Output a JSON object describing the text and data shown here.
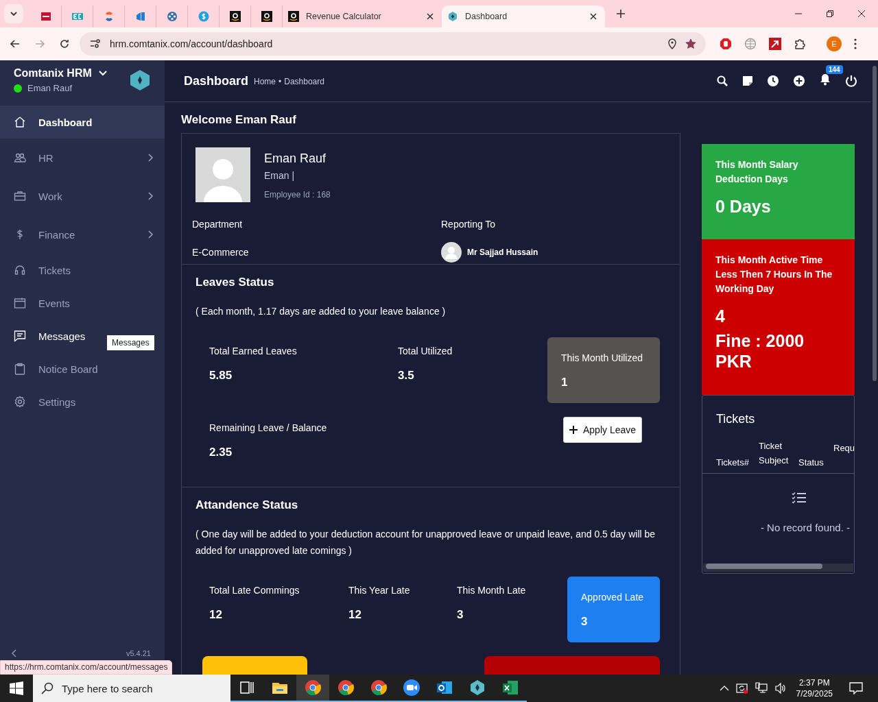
{
  "browser": {
    "tabs": [
      {
        "kind": "red-square",
        "selected": false
      },
      {
        "kind": "ec",
        "selected": false
      },
      {
        "kind": "swirl",
        "selected": false
      },
      {
        "kind": "blue-app",
        "selected": false
      },
      {
        "kind": "dots",
        "selected": false
      },
      {
        "kind": "coin",
        "selected": false
      },
      {
        "kind": "amazon",
        "selected": false
      },
      {
        "kind": "amazon",
        "selected": false
      },
      {
        "kind": "amazon",
        "label": "Revenue Calculator",
        "selected": false
      },
      {
        "kind": "hex",
        "label": "Dashboard",
        "selected": true
      }
    ],
    "url": "hrm.comtanix.com/account/dashboard",
    "bookmarked": true,
    "profile_initial": "E"
  },
  "sidebar": {
    "brand": "Comtanix HRM",
    "user": "Eman Rauf",
    "online": true,
    "items": [
      {
        "kind": "home",
        "label": "Dashboard",
        "selected": true,
        "hovered": false,
        "submenu": false
      },
      {
        "kind": "people",
        "label": "HR",
        "selected": false,
        "hovered": false,
        "submenu": true
      },
      {
        "kind": "briefcase",
        "label": "Work",
        "selected": false,
        "hovered": false,
        "submenu": true
      },
      {
        "kind": "dollar",
        "label": "Finance",
        "selected": false,
        "hovered": false,
        "submenu": true
      },
      {
        "kind": "headset",
        "label": "Tickets",
        "selected": false,
        "hovered": false,
        "submenu": false
      },
      {
        "kind": "calendar",
        "label": "Events",
        "selected": false,
        "hovered": false,
        "submenu": false
      },
      {
        "kind": "chat",
        "label": "Messages",
        "selected": false,
        "hovered": true,
        "submenu": false
      },
      {
        "kind": "clipboard",
        "label": "Notice Board",
        "selected": false,
        "hovered": false,
        "submenu": false
      },
      {
        "kind": "gear",
        "label": "Settings",
        "selected": false,
        "hovered": false,
        "submenu": false
      }
    ],
    "tooltip": "Messages",
    "version": "v5.4.21"
  },
  "header": {
    "title": "Dashboard",
    "breadcrumb": [
      "Home",
      "Dashboard"
    ],
    "separator": "•",
    "notifications": "144"
  },
  "welcome": "Welcome Eman Rauf",
  "profile": {
    "name": "Eman Rauf",
    "subtitle": "Eman |",
    "employee_id": "Employee Id : 168",
    "department_label": "Department",
    "department": "E-Commerce",
    "reporting_label": "Reporting To",
    "reporting_to": "Mr Sajjad Hussain"
  },
  "leaves": {
    "title": "Leaves Status",
    "note": "( Each month, 1.17 days are added to your leave balance )",
    "stats": [
      {
        "label": "Total Earned Leaves",
        "value": "5.85"
      },
      {
        "label": "Total Utilized",
        "value": "3.5"
      }
    ],
    "card": {
      "label": "This Month Utilized",
      "value": "1"
    },
    "balance": {
      "label": "Remaining Leave / Balance",
      "value": "2.35"
    },
    "button": "Apply Leave"
  },
  "attendance": {
    "title": "Attandence Status",
    "note": "( One day will be added to your deduction account for unapproved leave or unpaid leave, and 0.5 day will be added for unapproved late comings )",
    "stats": [
      {
        "label": "Total Late Commings",
        "value": "12"
      },
      {
        "label": "This Year Late",
        "value": "12"
      },
      {
        "label": "This Month Late",
        "value": "3"
      }
    ],
    "card": {
      "label": "Approved Late",
      "value": "3"
    },
    "more_cards": [
      {
        "color": "#ffc107"
      },
      {
        "color": "#b30000"
      }
    ]
  },
  "side_cards": [
    {
      "kind": "green",
      "title": "This Month Salary Deduction Days",
      "values": [
        "0 Days"
      ]
    },
    {
      "kind": "red",
      "title": "This Month Active Time Less Then 7 Hours In The Working Day",
      "values": [
        "4",
        "Fine : 2000 PKR"
      ]
    }
  ],
  "tickets": {
    "title": "Tickets",
    "columns": [
      "Tickets#",
      "Ticket Subject",
      "Status",
      "Requ"
    ],
    "empty": "- No record found. -"
  },
  "status_link": "https://hrm.comtanix.com/account/messages",
  "taskbar": {
    "search": "Type here to search",
    "apps": [
      {
        "kind": "taskview",
        "selected": false
      },
      {
        "kind": "folder",
        "selected": false
      },
      {
        "kind": "chrome",
        "selected": true
      },
      {
        "kind": "chrome",
        "selected": false
      },
      {
        "kind": "chrome",
        "selected": false
      },
      {
        "kind": "zoom",
        "selected": false
      },
      {
        "kind": "outlook",
        "selected": false
      },
      {
        "kind": "hex",
        "selected": false
      },
      {
        "kind": "excel",
        "selected": false
      }
    ],
    "time": "2:37 PM",
    "date": "7/29/2025"
  }
}
